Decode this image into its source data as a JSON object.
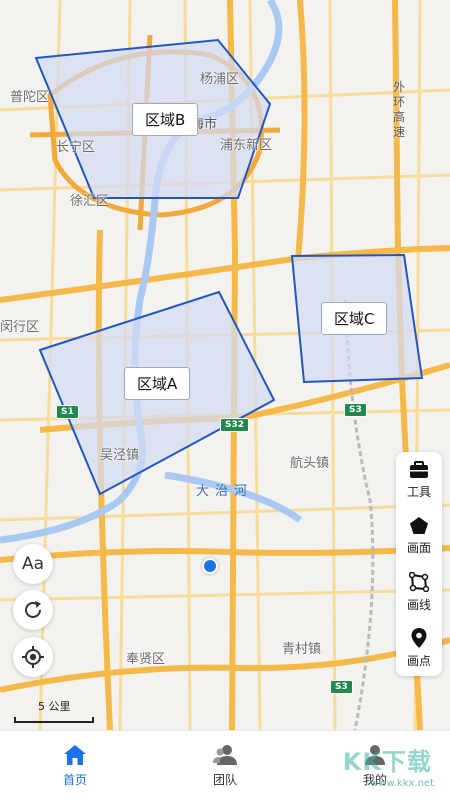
{
  "map": {
    "places": {
      "putuo": "普陀区",
      "yangpu": "杨浦区",
      "changning": "长宁区",
      "pudong": "浦东新区",
      "xuhui": "徐汇区",
      "minhang": "闵行区",
      "wujing": "吴泾镇",
      "hangtou": "航头镇",
      "fengxian": "奉贤区",
      "qingcun": "青村镇",
      "shang": "上海市"
    },
    "river": "大治河",
    "outer_ring": "外环高速",
    "shields": {
      "s1": "S1",
      "s32": "S32",
      "s3a": "S3",
      "s3b": "S3"
    }
  },
  "zones": {
    "a": {
      "label": "区域A"
    },
    "b": {
      "label": "区域B"
    },
    "c": {
      "label": "区域C"
    }
  },
  "toolbar": {
    "tools": "工具",
    "polygon": "画面",
    "line": "画线",
    "point": "画点"
  },
  "controls": {
    "font_size": "Aa",
    "scale_text": "5 公里"
  },
  "bottom_nav": {
    "home": "首页",
    "team": "团队",
    "mine": "我的"
  },
  "watermark": {
    "text": "KK下载",
    "url": "www.kkx.net"
  },
  "colors": {
    "accent": "#1a73e8",
    "zone_fill": "#d3dbf5",
    "zone_stroke": "#2057c4",
    "road_major": "#f5b94a",
    "road_minor": "#f8d88a",
    "river": "#a9c9f2"
  }
}
